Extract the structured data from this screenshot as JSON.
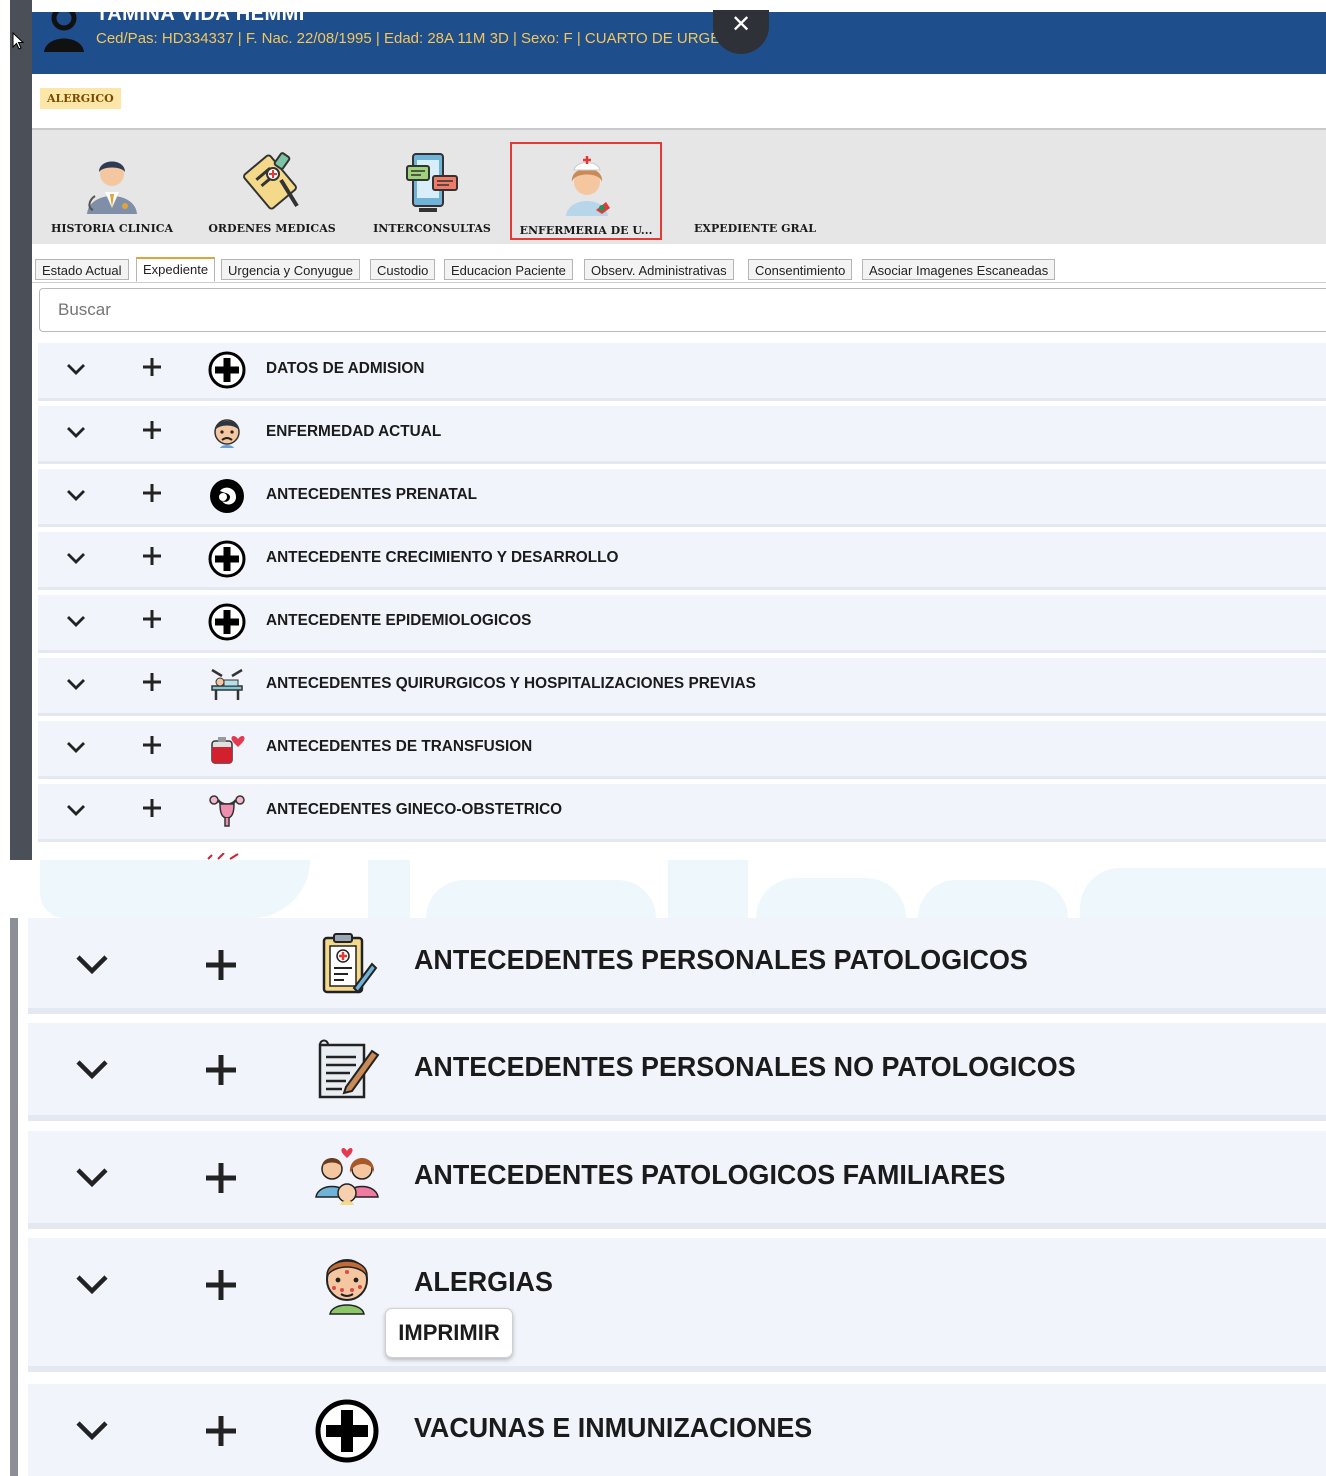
{
  "header": {
    "patient_name": "TAMINA VIDA HEMMI",
    "patient_info": "Ced/Pas: HD334337 | F. Nac. 22/08/1995 | Edad: 28A 11M 3D | Sexo: F  | CUARTO DE URGENCIA",
    "close_symbol": "✕"
  },
  "alert_badge": "ALERGICO",
  "modules": [
    {
      "label": "HISTORIA CLINICA",
      "icon": "doctor-icon"
    },
    {
      "label": "ORDENES MEDICAS",
      "icon": "prescription-pen-icon"
    },
    {
      "label": "INTERCONSULTAS",
      "icon": "consult-devices-icon"
    },
    {
      "label": "ENFERMERIA DE U...",
      "icon": "nurse-icon",
      "selected": true
    },
    {
      "label": "EXPEDIENTE GRAL",
      "icon": ""
    }
  ],
  "tabs": [
    {
      "label": "Estado Actual"
    },
    {
      "label": "Expediente",
      "active": true
    },
    {
      "label": "Urgencia y Conyugue"
    },
    {
      "label": "Custodio"
    },
    {
      "label": "Educacion Paciente"
    },
    {
      "label": "Observ. Administrativas"
    },
    {
      "label": "Consentimiento"
    },
    {
      "label": "Asociar Imagenes Escaneadas"
    }
  ],
  "search": {
    "placeholder": "Buscar"
  },
  "sections_top": [
    {
      "label": "DATOS DE ADMISION",
      "icon": "plus-circle-icon"
    },
    {
      "label": "ENFERMEDAD ACTUAL",
      "icon": "sick-person-icon"
    },
    {
      "label": "ANTECEDENTES PRENATAL",
      "icon": "baby-belly-icon"
    },
    {
      "label": "ANTECEDENTE CRECIMIENTO Y DESARROLLO",
      "icon": "plus-circle-icon"
    },
    {
      "label": "ANTECEDENTE EPIDEMIOLOGICOS",
      "icon": "plus-circle-icon"
    },
    {
      "label": "ANTECEDENTES QUIRURGICOS Y HOSPITALIZACIONES PREVIAS",
      "icon": "surgery-bed-icon"
    },
    {
      "label": "ANTECEDENTES DE TRANSFUSION",
      "icon": "blood-bag-icon"
    },
    {
      "label": "ANTECEDENTES GINECO-OBSTETRICO",
      "icon": "uterus-icon"
    }
  ],
  "sections_bottom": [
    {
      "label": "ANTECEDENTES PERSONALES PATOLOGICOS",
      "icon": "medical-clipboard-icon"
    },
    {
      "label": "ANTECEDENTES PERSONALES NO PATOLOGICOS",
      "icon": "notes-pencil-icon"
    },
    {
      "label": "ANTECEDENTES PATOLOGICOS FAMILIARES",
      "icon": "family-icon"
    },
    {
      "label": "ALERGIAS",
      "icon": "allergy-face-icon",
      "action_label": "IMPRIMIR"
    },
    {
      "label": "VACUNAS E INMUNIZACIONES",
      "icon": "plus-circle-icon"
    }
  ],
  "colors": {
    "header_bg": "#1f4e8c",
    "header_info_text": "#f3c75b",
    "alert_badge_bg": "#fde7a8",
    "row_bg": "#f1f5fb",
    "selected_module_border": "#e53935"
  }
}
